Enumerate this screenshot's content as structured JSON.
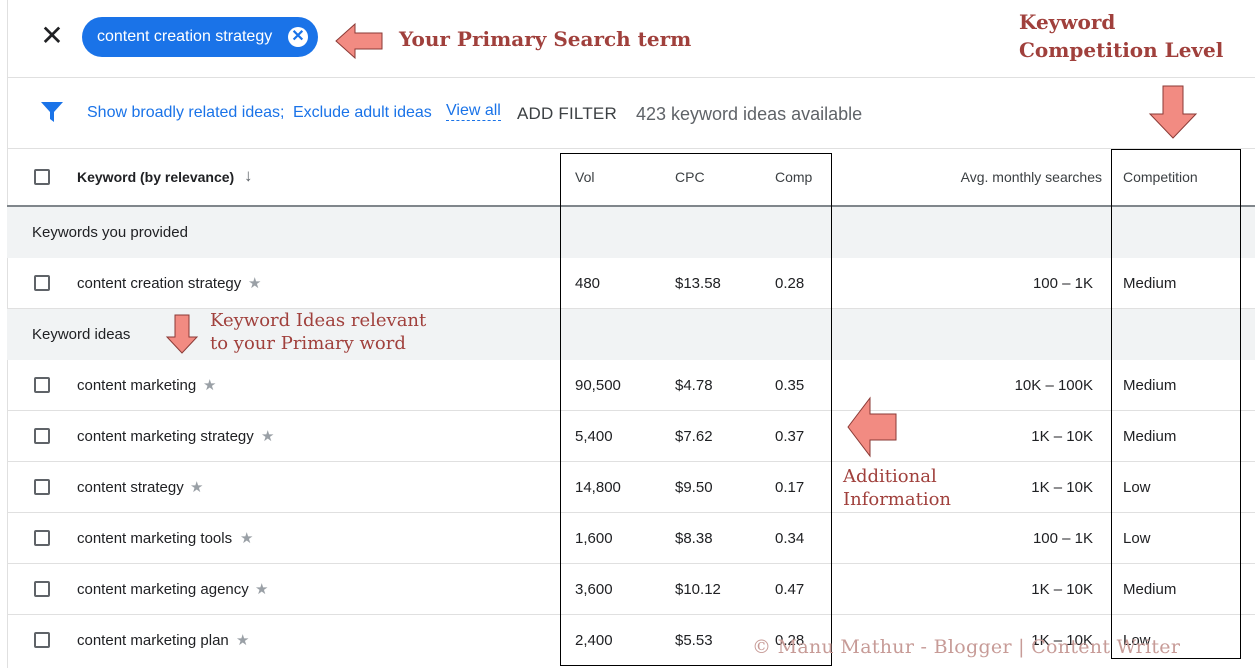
{
  "header": {
    "close_icon": "close-icon",
    "search_chip": "content creation strategy",
    "chip_clear_icon": "clear-circle-icon"
  },
  "annotations": {
    "primary_search": "Your Primary Search term",
    "competition_line1": "Keyword",
    "competition_line2": "Competition Level",
    "ideas_line1": "Keyword Ideas relevant",
    "ideas_line2": "to your Primary word",
    "additional_line1": "Additional",
    "additional_line2": "Information",
    "watermark": "© Manu Mathur - Blogger | Content Writer",
    "arrow_color": "#f28b82"
  },
  "filter_bar": {
    "filter_icon": "filter-funnel-icon",
    "filter1": "Show broadly related ideas;",
    "filter2": "Exclude adult ideas",
    "view_all": "View all",
    "add_filter": "ADD FILTER",
    "available": "423 keyword ideas available"
  },
  "table": {
    "columns": {
      "keyword": "Keyword (by relevance)",
      "vol": "Vol",
      "cpc": "CPC",
      "comp": "Comp",
      "avg": "Avg. monthly searches",
      "competition": "Competition"
    },
    "sort_icon": "arrow-down-icon",
    "group_provided": "Keywords you provided",
    "group_ideas": "Keyword ideas",
    "provided_rows": [
      {
        "keyword": "content creation strategy",
        "vol": "480",
        "cpc": "$13.58",
        "comp": "0.28",
        "avg": "100 – 1K",
        "competition": "Medium"
      }
    ],
    "idea_rows": [
      {
        "keyword": "content marketing",
        "vol": "90,500",
        "cpc": "$4.78",
        "comp": "0.35",
        "avg": "10K – 100K",
        "competition": "Medium"
      },
      {
        "keyword": "content marketing strategy",
        "vol": "5,400",
        "cpc": "$7.62",
        "comp": "0.37",
        "avg": "1K – 10K",
        "competition": "Medium"
      },
      {
        "keyword": "content strategy",
        "vol": "14,800",
        "cpc": "$9.50",
        "comp": "0.17",
        "avg": "1K – 10K",
        "competition": "Low"
      },
      {
        "keyword": "content marketing tools",
        "vol": "1,600",
        "cpc": "$8.38",
        "comp": "0.34",
        "avg": "100 – 1K",
        "competition": "Low"
      },
      {
        "keyword": "content marketing agency",
        "vol": "3,600",
        "cpc": "$10.12",
        "comp": "0.47",
        "avg": "1K – 10K",
        "competition": "Medium"
      },
      {
        "keyword": "content marketing plan",
        "vol": "2,400",
        "cpc": "$5.53",
        "comp": "0.28",
        "avg": "1K – 10K",
        "competition": "Low"
      }
    ]
  }
}
